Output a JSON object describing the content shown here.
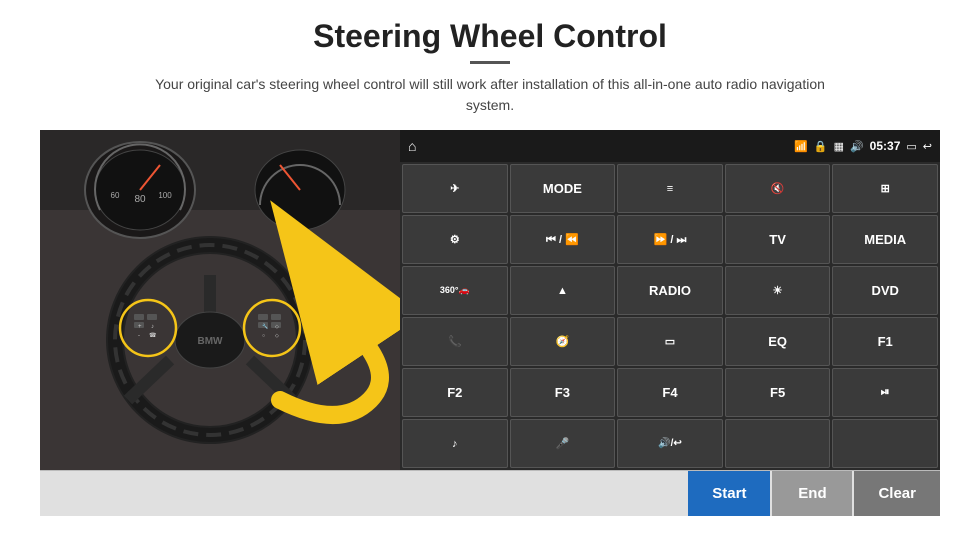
{
  "header": {
    "title": "Steering Wheel Control",
    "underline": true,
    "subtitle": "Your original car's steering wheel control will still work after installation of this all-in-one auto radio navigation system."
  },
  "panel": {
    "statusbar": {
      "home_icon": "⌂",
      "wifi_icon": "📶",
      "lock_icon": "🔒",
      "sim_icon": "📱",
      "audio_icon": "🔊",
      "time": "05:37",
      "screen_icon": "▭",
      "back_icon": "↩"
    },
    "buttons": [
      {
        "label": "✈",
        "type": "icon"
      },
      {
        "label": "MODE",
        "type": "text"
      },
      {
        "label": "≡",
        "type": "icon"
      },
      {
        "label": "🔇",
        "type": "icon"
      },
      {
        "label": "⊞",
        "type": "icon"
      },
      {
        "label": "⚙",
        "type": "icon"
      },
      {
        "label": "⏮",
        "type": "icon"
      },
      {
        "label": "⏭",
        "type": "icon"
      },
      {
        "label": "TV",
        "type": "text"
      },
      {
        "label": "MEDIA",
        "type": "text"
      },
      {
        "label": "360°",
        "type": "text"
      },
      {
        "label": "▲",
        "type": "icon"
      },
      {
        "label": "RADIO",
        "type": "text"
      },
      {
        "label": "☀",
        "type": "icon"
      },
      {
        "label": "DVD",
        "type": "text"
      },
      {
        "label": "📞",
        "type": "icon"
      },
      {
        "label": "⊙",
        "type": "icon"
      },
      {
        "label": "▭",
        "type": "icon"
      },
      {
        "label": "EQ",
        "type": "text"
      },
      {
        "label": "F1",
        "type": "text"
      },
      {
        "label": "F2",
        "type": "text"
      },
      {
        "label": "F3",
        "type": "text"
      },
      {
        "label": "F4",
        "type": "text"
      },
      {
        "label": "F5",
        "type": "text"
      },
      {
        "label": "⏯",
        "type": "icon"
      },
      {
        "label": "♪",
        "type": "icon"
      },
      {
        "label": "🎤",
        "type": "icon"
      },
      {
        "label": "🔊/↩",
        "type": "icon"
      },
      {
        "label": "",
        "type": "empty"
      },
      {
        "label": "",
        "type": "empty"
      }
    ]
  },
  "bottom_bar": {
    "start_label": "Start",
    "end_label": "End",
    "clear_label": "Clear"
  }
}
